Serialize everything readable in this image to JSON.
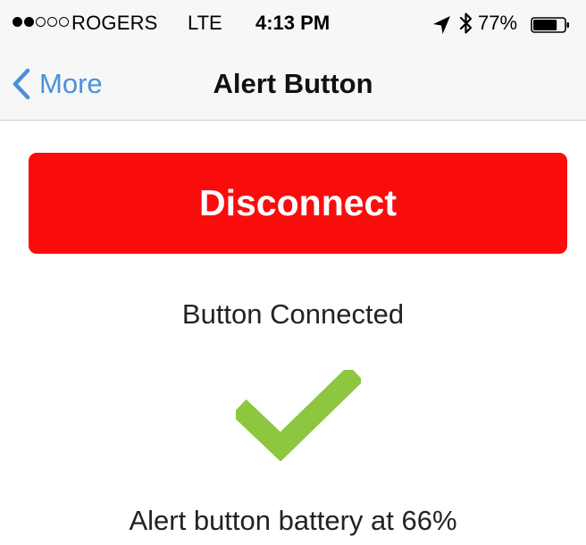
{
  "status_bar": {
    "signal_dots_filled": 2,
    "signal_dots_total": 5,
    "carrier": "ROGERS",
    "network": "LTE",
    "time": "4:13 PM",
    "location_icon": "location-arrow-icon",
    "bluetooth_icon": "bluetooth-icon",
    "battery_percent_label": "77%",
    "battery_level": 0.77
  },
  "nav": {
    "back_label": "More",
    "back_icon": "chevron-left-icon",
    "title": "Alert Button"
  },
  "main": {
    "disconnect_label": "Disconnect",
    "connection_status": "Button Connected",
    "status_icon": "checkmark-icon",
    "battery_status": "Alert button battery at 66%"
  },
  "colors": {
    "accent_blue": "#4a90d9",
    "disconnect_red": "#fb0c0c",
    "check_green": "#8dc63f",
    "bar_background": "#f7f7f7"
  }
}
